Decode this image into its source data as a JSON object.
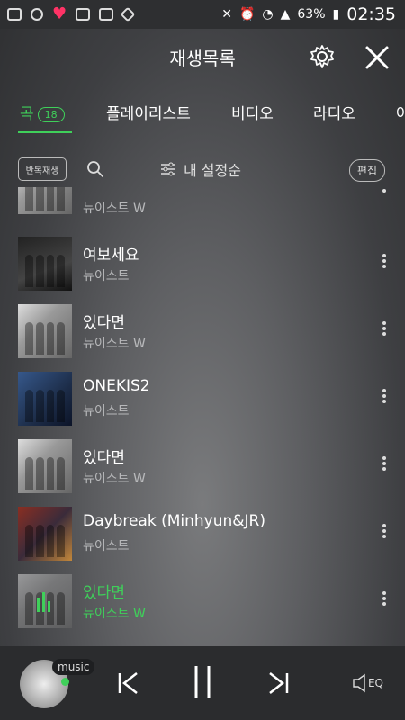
{
  "status": {
    "time": "02:35",
    "battery": "63%"
  },
  "header": {
    "title": "재생목록"
  },
  "tabs": [
    {
      "label": "곡",
      "badge": "18"
    },
    {
      "label": "플레이리스트"
    },
    {
      "label": "비디오"
    },
    {
      "label": "라디오"
    },
    {
      "label": "아"
    }
  ],
  "toolbar": {
    "repeat": "반복재생",
    "sort": "내 설정순",
    "edit": "편집"
  },
  "songs": [
    {
      "title": "",
      "artist": "뉴이스트 W"
    },
    {
      "title": "여보세요",
      "artist": "뉴이스트"
    },
    {
      "title": "있다면",
      "artist": "뉴이스트 W"
    },
    {
      "title": "ONEKIS2",
      "artist": "뉴이스트"
    },
    {
      "title": "있다면",
      "artist": "뉴이스트 W"
    },
    {
      "title": "Daybreak (Minhyun&JR)",
      "artist": "뉴이스트"
    },
    {
      "title": "있다면",
      "artist": "뉴이스트 W"
    }
  ],
  "player": {
    "tag": "music",
    "eq": "EQ"
  },
  "colors": {
    "accent": "#3fd05a"
  }
}
